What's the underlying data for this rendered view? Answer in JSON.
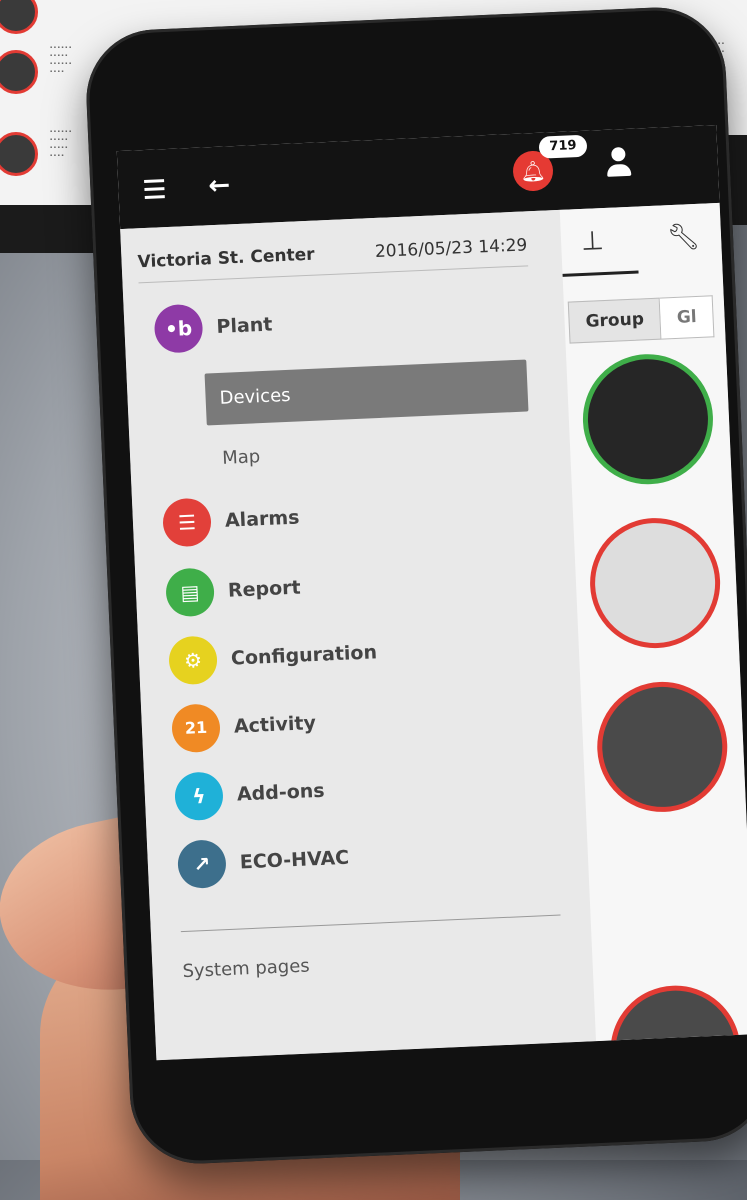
{
  "header": {
    "notification_count": "719",
    "menu_icon": "hamburger-menu-icon",
    "back_icon": "arrow-left-icon",
    "bell_icon": "bell-icon",
    "user_icon": "user-icon"
  },
  "site": {
    "name": "Victoria St. Center",
    "datetime": "2016/05/23  14:29"
  },
  "nav": {
    "items": [
      {
        "label": "Plant",
        "color": "#8e3aa6",
        "icon": "plant-icon"
      },
      {
        "label": "Alarms",
        "color": "#e2403a",
        "icon": "alarms-list-icon"
      },
      {
        "label": "Report",
        "color": "#3fae49",
        "icon": "report-icon"
      },
      {
        "label": "Configuration",
        "color": "#e6d21f",
        "icon": "gears-icon"
      },
      {
        "label": "Activity",
        "color": "#f08a24",
        "icon": "calendar-icon"
      },
      {
        "label": "Add-ons",
        "color": "#1fb1d8",
        "icon": "lightning-icon"
      },
      {
        "label": "ECO-HVAC",
        "color": "#3d6f8c",
        "icon": "chart-trend-icon"
      }
    ],
    "sub_items": [
      {
        "label": "Devices",
        "active": true
      },
      {
        "label": "Map",
        "active": false
      }
    ],
    "system_pages": "System pages"
  },
  "right_pane": {
    "tabs": [
      "tree-view-icon",
      "wrench-icon"
    ],
    "segment": [
      "Group",
      "Gl"
    ]
  },
  "colors": {
    "topbar": "#131313",
    "accent_red": "#e53a33",
    "active_item": "#7a7a7a"
  }
}
